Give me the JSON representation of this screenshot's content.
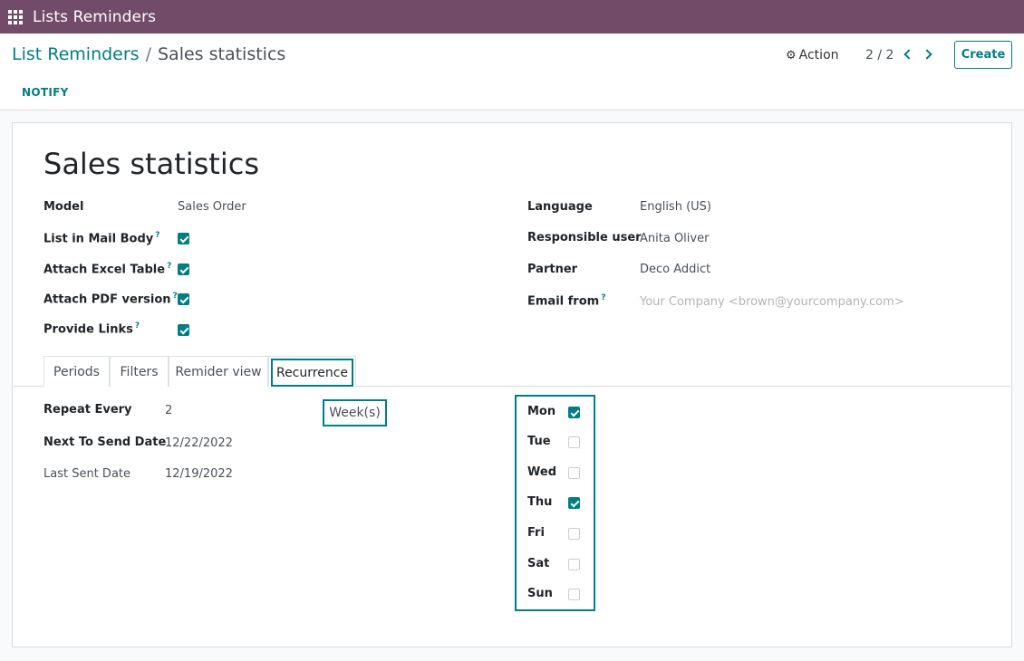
{
  "navbar": {
    "app_title": "Lists Reminders"
  },
  "breadcrumb": {
    "parent": "List Reminders",
    "separator": "/",
    "current": "Sales statistics"
  },
  "toolbar": {
    "action_label": "Action",
    "pager": "2 / 2",
    "create_label": "Create",
    "notify_label": "NOTIFY"
  },
  "record": {
    "title": "Sales statistics",
    "left_fields": {
      "model_label": "Model",
      "model_value": "Sales Order",
      "list_body_label": "List in Mail Body",
      "list_body_checked": true,
      "excel_label": "Attach Excel Table",
      "excel_checked": true,
      "pdf_label": "Attach PDF version",
      "pdf_checked": true,
      "links_label": "Provide Links",
      "links_checked": true,
      "help_mark": "?"
    },
    "right_fields": {
      "language_label": "Language",
      "language_value": "English (US)",
      "user_label": "Responsible user",
      "user_value": "Anita Oliver",
      "partner_label": "Partner",
      "partner_value": "Deco Addict",
      "email_label": "Email from",
      "email_placeholder": "Your Company <brown@yourcompany.com>"
    }
  },
  "tabs": [
    {
      "label": "Periods"
    },
    {
      "label": "Filters"
    },
    {
      "label": "Remider view"
    },
    {
      "label": "Recurrence",
      "active": true
    }
  ],
  "recurrence": {
    "repeat_label": "Repeat Every",
    "repeat_value": "2",
    "repeat_unit": "Week(s)",
    "next_label": "Next To Send Date",
    "next_value": "12/22/2022",
    "last_label": "Last Sent Date",
    "last_value": "12/19/2022",
    "days": [
      {
        "label": "Mon",
        "checked": true
      },
      {
        "label": "Tue",
        "checked": false
      },
      {
        "label": "Wed",
        "checked": false
      },
      {
        "label": "Thu",
        "checked": true
      },
      {
        "label": "Fri",
        "checked": false
      },
      {
        "label": "Sat",
        "checked": false
      },
      {
        "label": "Sun",
        "checked": false
      }
    ]
  },
  "colors": {
    "navbar": "#714b67",
    "accent": "#017e84"
  }
}
